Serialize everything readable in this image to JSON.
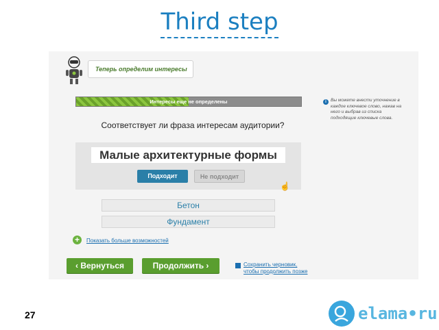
{
  "slide": {
    "title": "Third step",
    "page_number": "27"
  },
  "header": {
    "bubble_text": "Теперь определим интересы"
  },
  "progress": {
    "label": "Интересы еще не определены",
    "fill_fraction": 0.5
  },
  "hint": {
    "text": "Вы можете внести уточнение в каждое ключевое слово, нажав на него и выбрав из списка подходящие ключевые слова."
  },
  "main": {
    "question": "Соответствует ли фраза интересам аудитории?",
    "phrase": "Малые архитектурные формы",
    "yes_label": "Подходит",
    "no_label": "Не подходит",
    "keywords": [
      "Бетон",
      "Фундамент"
    ],
    "more_label": "Показать больше возможностей"
  },
  "footer": {
    "back_label": "‹ Вернуться",
    "next_label": "Продолжить ›",
    "save_line1": "Сохранить черновик,",
    "save_line2": "чтобы продолжить позже"
  },
  "logo": {
    "text": "elama•ru"
  },
  "colors": {
    "accent": "#1b7fc0",
    "green": "#5a9e2f",
    "button_blue": "#2a7fa8"
  }
}
